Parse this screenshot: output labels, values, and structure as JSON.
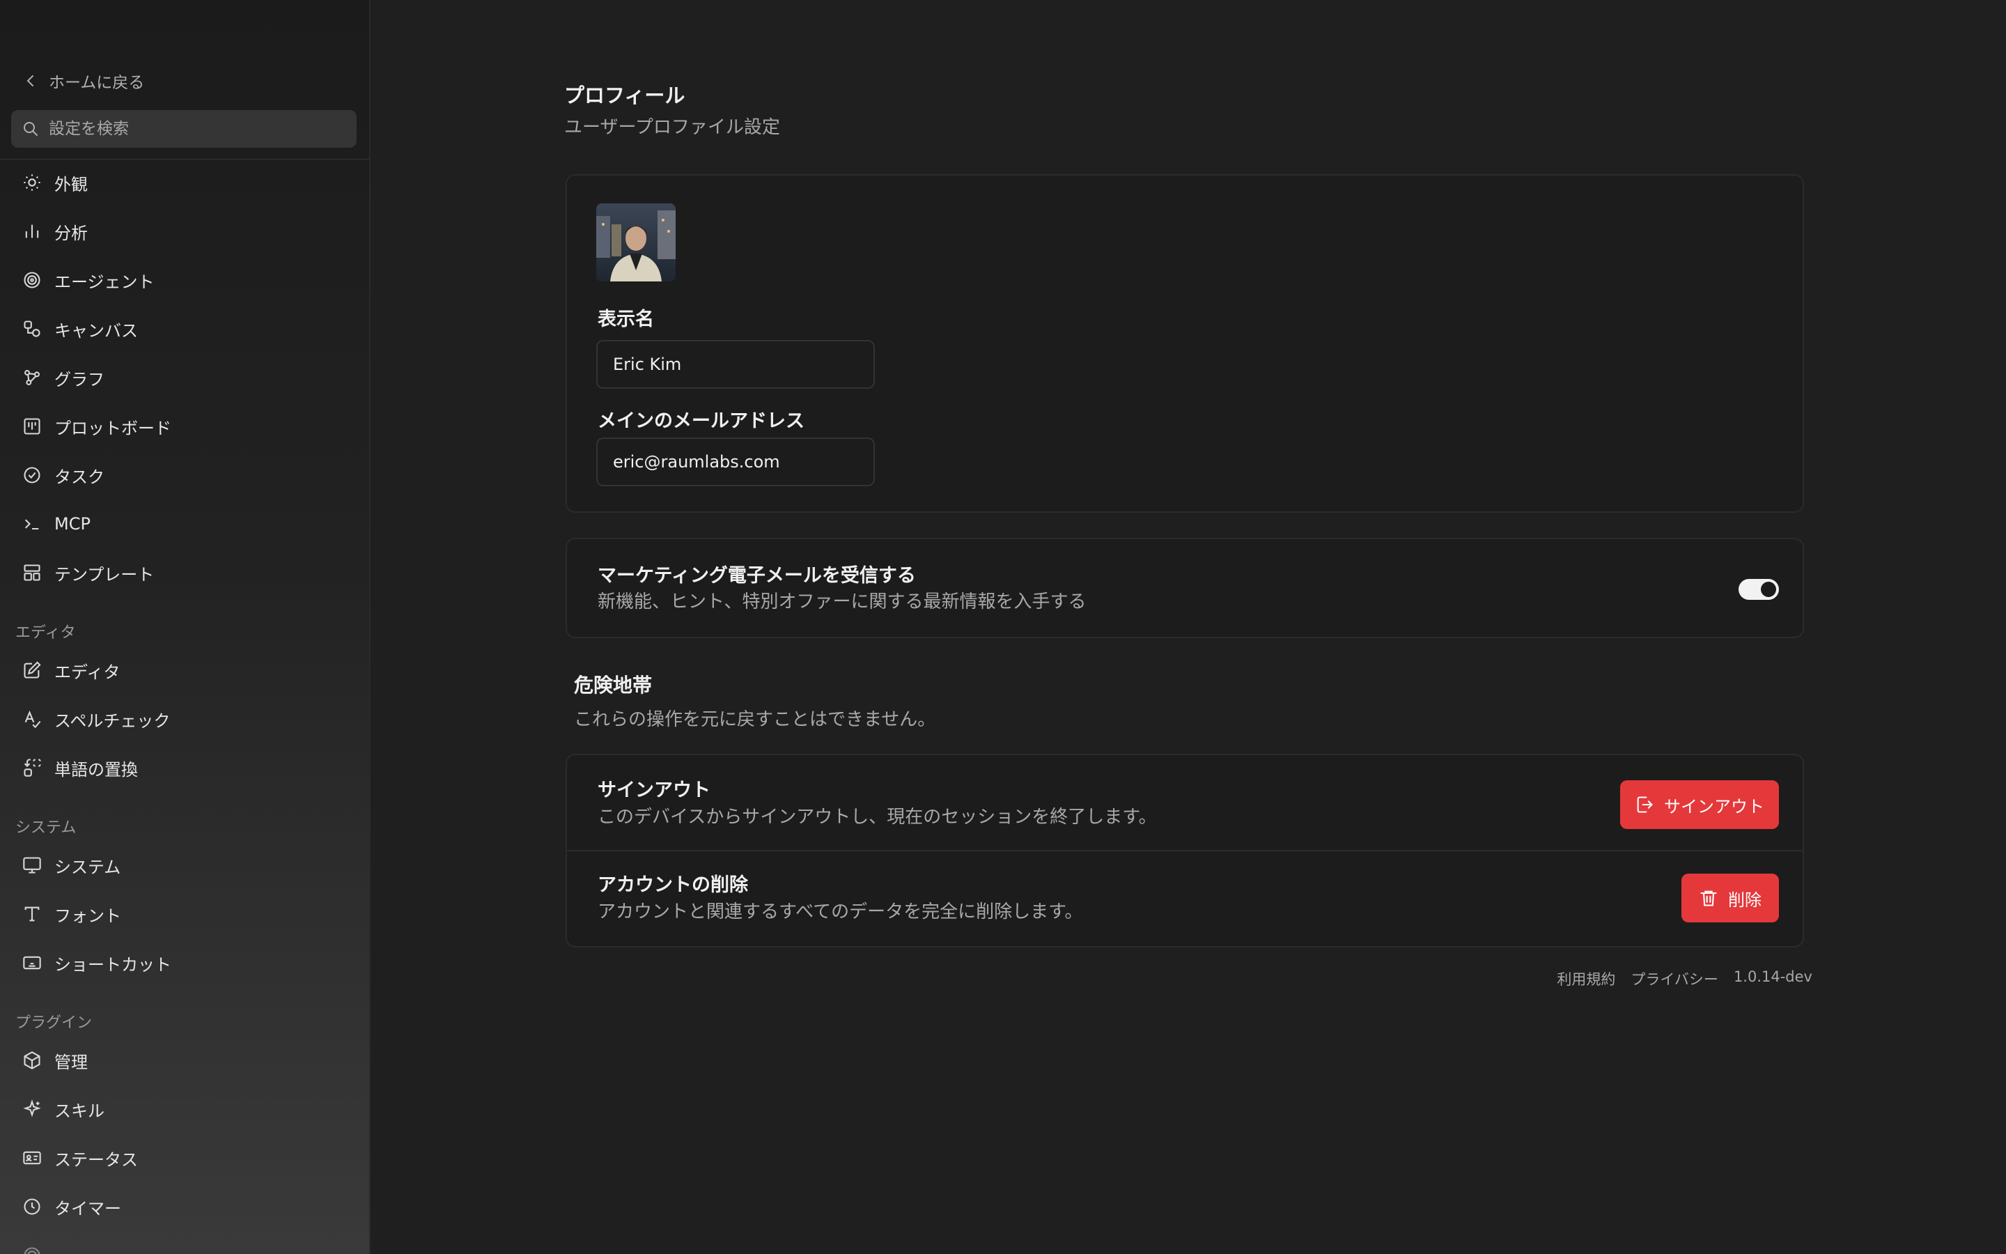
{
  "sidebar": {
    "back_label": "ホームに戻る",
    "search_placeholder": "設定を検索",
    "items": [
      {
        "label": "外観",
        "icon": "sun-icon"
      },
      {
        "label": "分析",
        "icon": "bar-chart-icon"
      },
      {
        "label": "エージェント",
        "icon": "spiral-icon"
      },
      {
        "label": "キャンバス",
        "icon": "shapes-icon"
      },
      {
        "label": "グラフ",
        "icon": "graph-nodes-icon"
      },
      {
        "label": "プロットボード",
        "icon": "kanban-icon"
      },
      {
        "label": "タスク",
        "icon": "check-circle-icon"
      },
      {
        "label": "MCP",
        "icon": "terminal-icon"
      },
      {
        "label": "テンプレート",
        "icon": "template-icon"
      }
    ],
    "sections": [
      {
        "label": "エディタ",
        "items": [
          {
            "label": "エディタ",
            "icon": "edit-icon"
          },
          {
            "label": "スペルチェック",
            "icon": "spell-check-icon"
          },
          {
            "label": "単語の置換",
            "icon": "replace-icon"
          }
        ]
      },
      {
        "label": "システム",
        "items": [
          {
            "label": "システム",
            "icon": "monitor-icon"
          },
          {
            "label": "フォント",
            "icon": "type-icon"
          },
          {
            "label": "ショートカット",
            "icon": "keyboard-icon"
          }
        ]
      },
      {
        "label": "プラグイン",
        "items": [
          {
            "label": "管理",
            "icon": "package-icon"
          },
          {
            "label": "スキル",
            "icon": "sparkles-icon"
          },
          {
            "label": "ステータス",
            "icon": "id-card-icon"
          },
          {
            "label": "タイマー",
            "icon": "clock-icon"
          }
        ]
      }
    ]
  },
  "profile": {
    "title": "プロフィール",
    "subtitle": "ユーザープロファイル設定",
    "display_name_label": "表示名",
    "display_name_value": "Eric Kim",
    "email_label": "メインのメールアドレス",
    "email_value": "eric@raumlabs.com"
  },
  "marketing": {
    "title": "マーケティング電子メールを受信する",
    "description": "新機能、ヒント、特別オファーに関する最新情報を入手する",
    "enabled": true
  },
  "danger": {
    "title": "危険地帯",
    "description": "これらの操作を元に戻すことはできません。",
    "signout_title": "サインアウト",
    "signout_desc": "このデバイスからサインアウトし、現在のセッションを終了します。",
    "signout_button": "サインアウト",
    "delete_title": "アカウントの削除",
    "delete_desc": "アカウントと関連するすべてのデータを完全に削除します。",
    "delete_button": "削除"
  },
  "footer": {
    "terms": "利用規約",
    "privacy": "プライバシー",
    "version": "1.0.14-dev"
  },
  "colors": {
    "danger": "#e5383b",
    "background": "#1f1f1f"
  }
}
